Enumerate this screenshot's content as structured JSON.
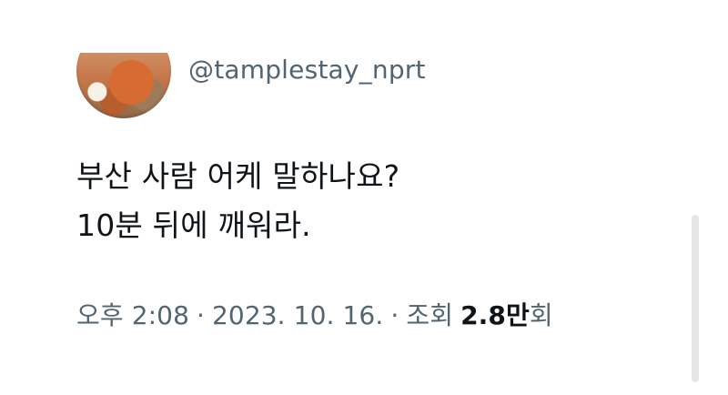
{
  "profile": {
    "handle": "@tamplestay_nprt"
  },
  "tweet": {
    "line1": "부산 사람 어케 말하나요?",
    "line2": "10분 뒤에 깨워라."
  },
  "meta": {
    "time": "오후 2:08",
    "separator1": "·",
    "date": "2023. 10. 16.",
    "separator2": "·",
    "views_label": "조회",
    "views_count": "2.8만",
    "views_unit": "회"
  }
}
